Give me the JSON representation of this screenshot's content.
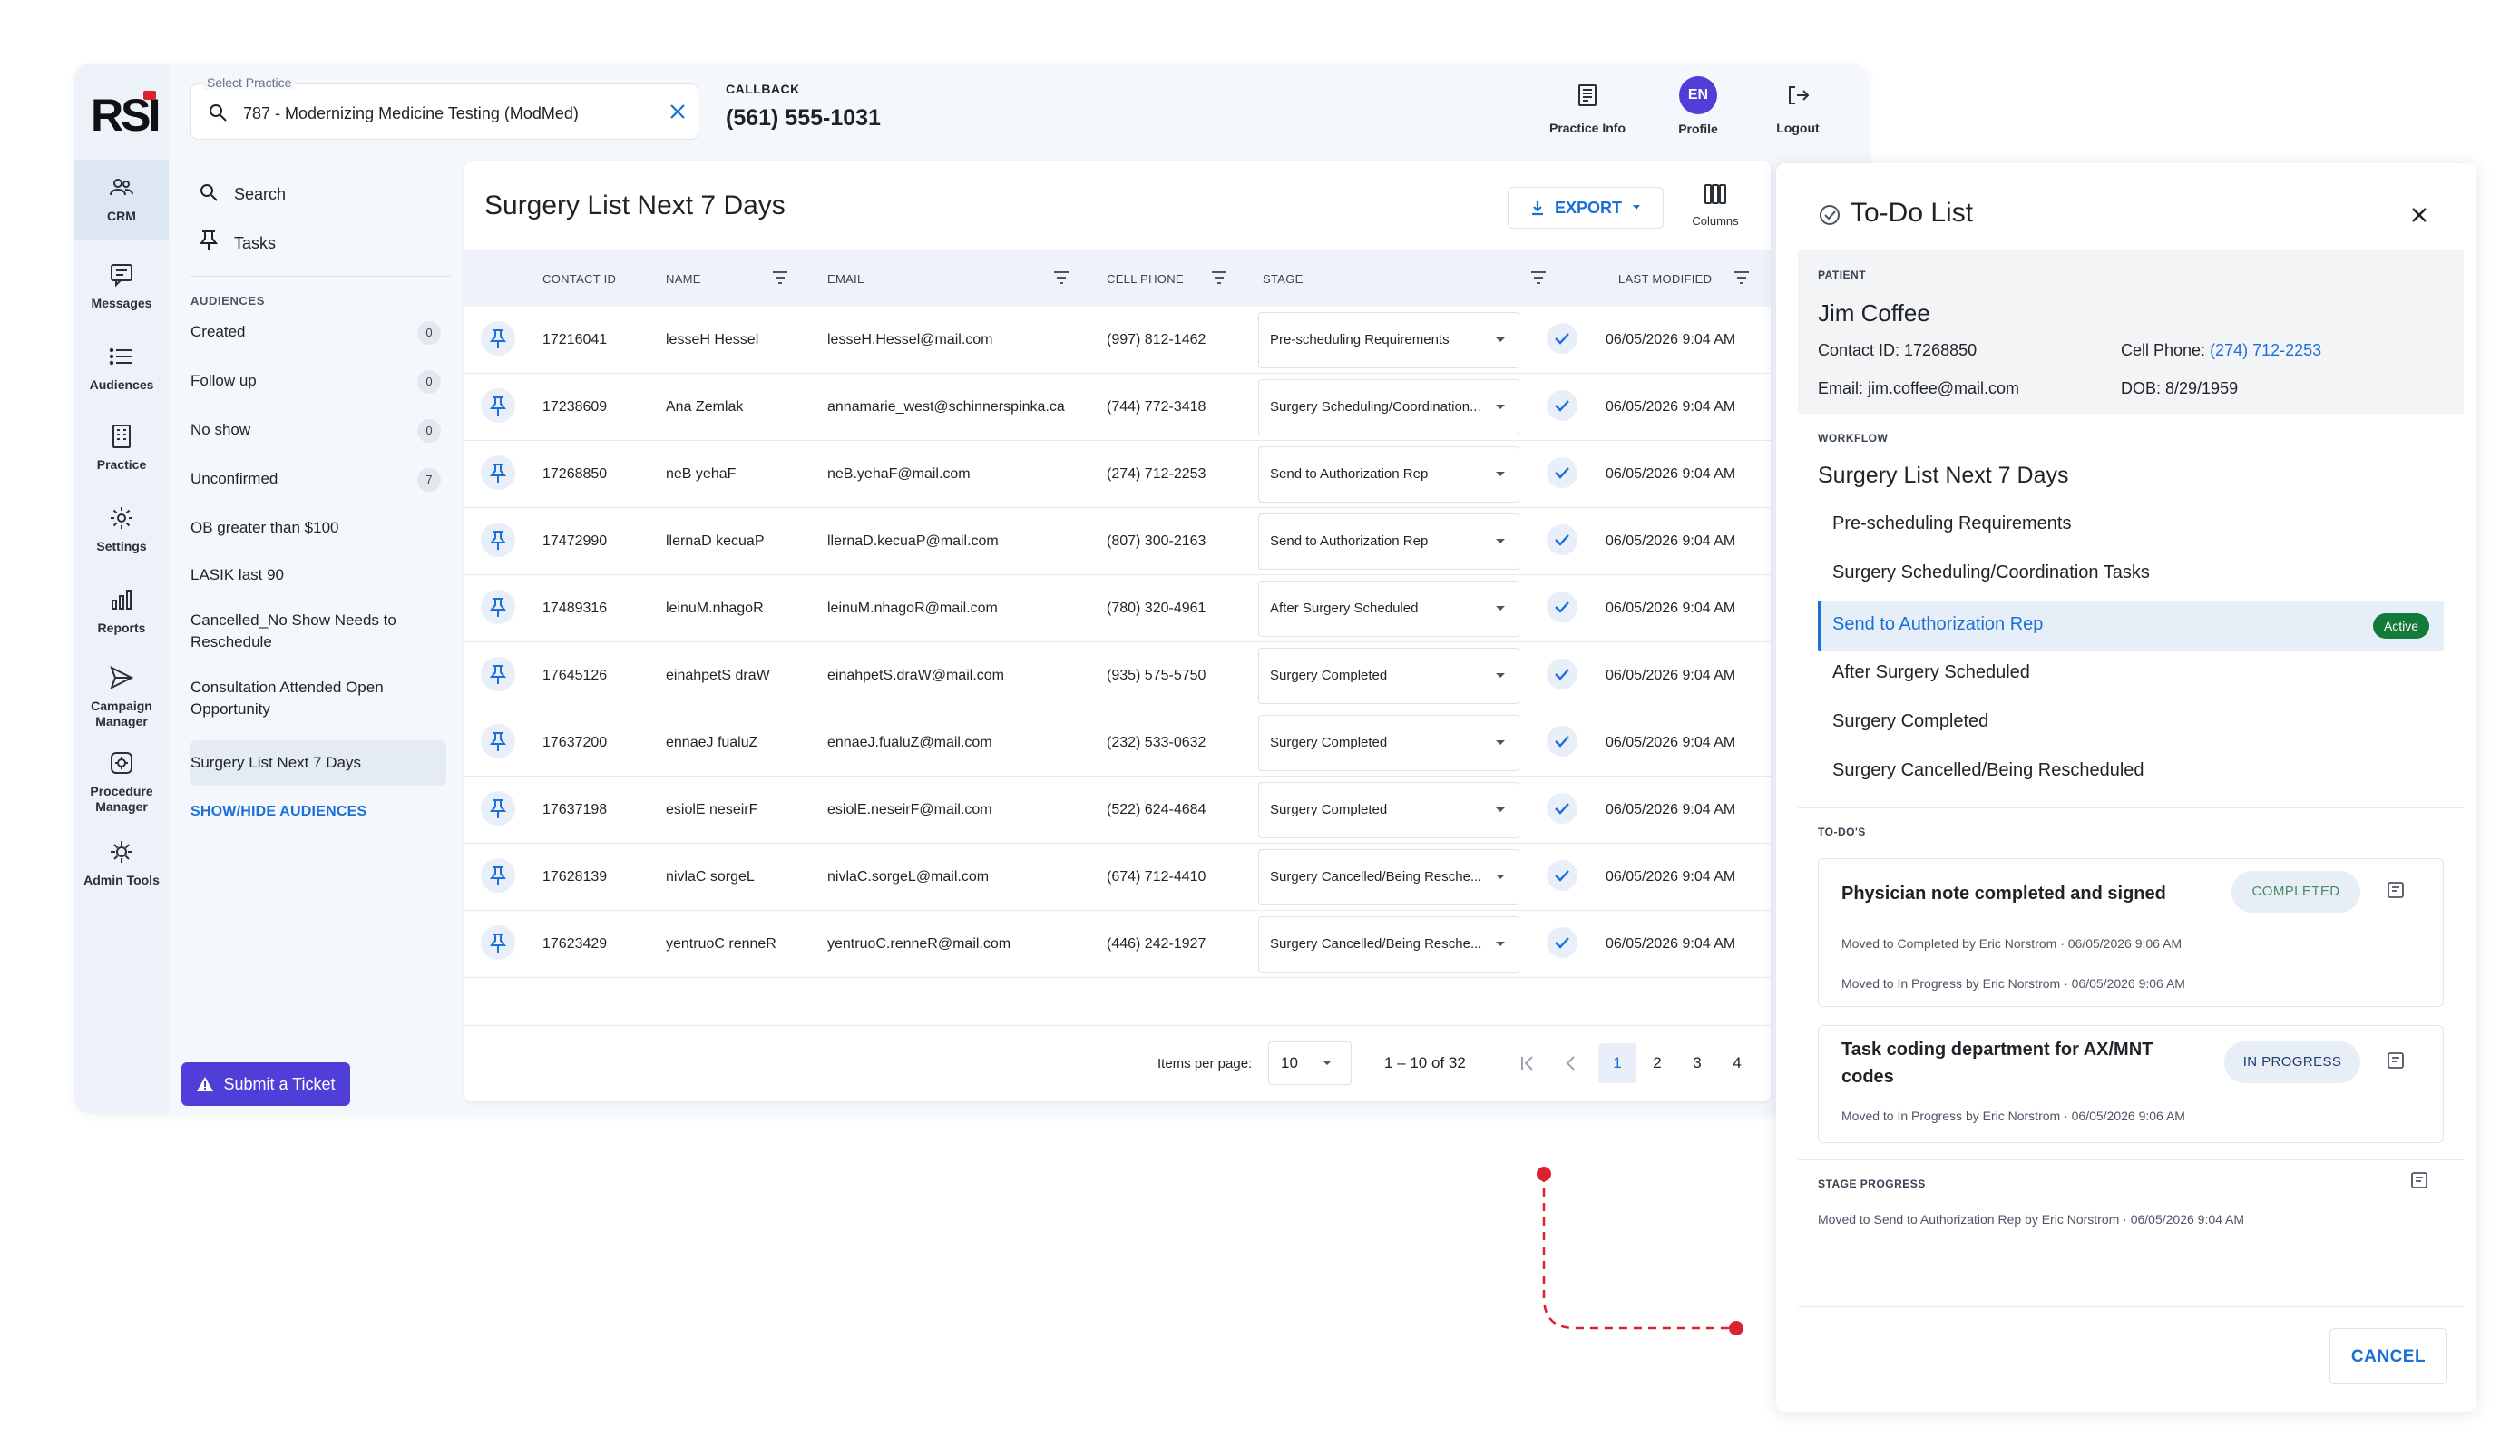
{
  "brand": {
    "logo_text": "RSI",
    "accent": "#1a6fd8",
    "brand_purple": "#4f3fd8",
    "logo_red": "#d9232e"
  },
  "rail": [
    {
      "label": "CRM",
      "icon": "users-icon"
    },
    {
      "label": "Messages",
      "icon": "message-icon"
    },
    {
      "label": "Audiences",
      "icon": "list-icon"
    },
    {
      "label": "Practice",
      "icon": "building-icon"
    },
    {
      "label": "Settings",
      "icon": "gear-icon"
    },
    {
      "label": "Reports",
      "icon": "bar-chart-icon"
    },
    {
      "label": "Campaign Manager",
      "icon": "send-icon"
    },
    {
      "label": "Procedure Manager",
      "icon": "procedure-icon"
    },
    {
      "label": "Admin Tools",
      "icon": "admin-gear-icon"
    }
  ],
  "topbar": {
    "select_label": "Select Practice",
    "select_value": "787 - Modernizing Medicine Testing (ModMed)",
    "callback_label": "CALLBACK",
    "callback_phone": "(561) 555-1031",
    "practice_info": "Practice Info",
    "profile_initials": "EN",
    "profile": "Profile",
    "logout": "Logout"
  },
  "sidebar": {
    "search": "Search",
    "tasks": "Tasks",
    "audiences_title": "AUDIENCES",
    "audiences": [
      {
        "label": "Created",
        "count": "0"
      },
      {
        "label": "Follow up",
        "count": "0"
      },
      {
        "label": "No show",
        "count": "0"
      },
      {
        "label": "Unconfirmed",
        "count": "7"
      },
      {
        "label": "OB greater than $100",
        "count": ""
      },
      {
        "label": "LASIK last 90",
        "count": ""
      },
      {
        "label": "Cancelled_No Show Needs to Reschedule",
        "count": ""
      },
      {
        "label": "Consultation Attended Open Opportunity",
        "count": ""
      },
      {
        "label": "Surgery List Next 7 Days",
        "count": ""
      }
    ],
    "show_hide": "SHOW/HIDE AUDIENCES",
    "submit_ticket": "Submit a Ticket"
  },
  "main": {
    "title": "Surgery List Next 7 Days",
    "export": "EXPORT",
    "columns": "Columns",
    "headers": [
      "CONTACT ID",
      "NAME",
      "EMAIL",
      "CELL PHONE",
      "STAGE",
      "LAST MODIFIED"
    ],
    "rows": [
      {
        "id": "17216041",
        "name": "lesseH Hessel",
        "email": "lesseH.Hessel@mail.com",
        "phone": "(997) 812-1462",
        "stage": "Pre-scheduling Requirements",
        "modified": "06/05/2026 9:04 AM"
      },
      {
        "id": "17238609",
        "name": "Ana Zemlak",
        "email": "annamarie_west@schinnerspinka.ca",
        "phone": "(744) 772-3418",
        "stage": "Surgery Scheduling/Coordination...",
        "modified": "06/05/2026 9:04 AM"
      },
      {
        "id": "17268850",
        "name": "neB yehaF",
        "email": "neB.yehaF@mail.com",
        "phone": "(274) 712-2253",
        "stage": "Send to Authorization Rep",
        "modified": "06/05/2026 9:04 AM"
      },
      {
        "id": "17472990",
        "name": "llernaD kecuaP",
        "email": "llernaD.kecuaP@mail.com",
        "phone": "(807) 300-2163",
        "stage": "Send to Authorization Rep",
        "modified": "06/05/2026 9:04 AM"
      },
      {
        "id": "17489316",
        "name": "leinuM.nhagoR",
        "email": "leinuM.nhagoR@mail.com",
        "phone": "(780) 320-4961",
        "stage": "After Surgery Scheduled",
        "modified": "06/05/2026 9:04 AM"
      },
      {
        "id": "17645126",
        "name": "einahpetS draW",
        "email": "einahpetS.draW@mail.com",
        "phone": "(935) 575-5750",
        "stage": "Surgery Completed",
        "modified": "06/05/2026 9:04 AM"
      },
      {
        "id": "17637200",
        "name": "ennaeJ fualuZ",
        "email": "ennaeJ.fualuZ@mail.com",
        "phone": "(232) 533-0632",
        "stage": "Surgery Completed",
        "modified": "06/05/2026 9:04 AM"
      },
      {
        "id": "17637198",
        "name": "esiolE neseirF",
        "email": "esiolE.neseirF@mail.com",
        "phone": "(522) 624-4684",
        "stage": "Surgery Completed",
        "modified": "06/05/2026 9:04 AM"
      },
      {
        "id": "17628139",
        "name": "nivlaC sorgeL",
        "email": "nivlaC.sorgeL@mail.com",
        "phone": "(674) 712-4410",
        "stage": "Surgery Cancelled/Being Resche...",
        "modified": "06/05/2026 9:04 AM"
      },
      {
        "id": "17623429",
        "name": "yentruoC renneR",
        "email": "yentruoC.renneR@mail.com",
        "phone": "(446) 242-1927",
        "stage": "Surgery Cancelled/Being Resche...",
        "modified": "06/05/2026 9:04 AM"
      }
    ],
    "pager": {
      "per_page_label": "Items per page:",
      "per_page": "10",
      "range": "1 – 10 of 32",
      "pages": [
        "1",
        "2",
        "3",
        "4"
      ],
      "current": "1"
    }
  },
  "todo": {
    "title": "To-Do List",
    "patient_label": "PATIENT",
    "patient_name": "Jim Coffee",
    "contact_id": "Contact ID: 17268850",
    "cell_label": "Cell Phone: ",
    "cell_phone": "(274) 712-2253",
    "email": "Email: jim.coffee@mail.com",
    "dob": "DOB: 8/29/1959",
    "workflow_label": "WORKFLOW",
    "workflow_name": "Surgery List Next 7 Days",
    "workflow_steps": [
      "Pre-scheduling Requirements",
      "Surgery Scheduling/Coordination Tasks",
      "Send to Authorization Rep",
      "After Surgery Scheduled",
      "Surgery Completed",
      "Surgery Cancelled/Being Rescheduled"
    ],
    "active_badge": "Active",
    "todos_label": "TO-DO'S",
    "todos": [
      {
        "title": "Physician note completed and signed",
        "status": "COMPLETED",
        "log": [
          "Moved to Completed by Eric Norstrom · 06/05/2026 9:06 AM",
          "Moved to In Progress by Eric Norstrom · 06/05/2026 9:06 AM"
        ]
      },
      {
        "title_line1": "Task coding department for AX/MNT",
        "title_line2": "codes",
        "status": "IN PROGRESS",
        "log": [
          "Moved to In Progress by Eric Norstrom · 06/05/2026 9:06 AM"
        ]
      }
    ],
    "stage_progress_label": "STAGE PROGRESS",
    "stage_progress_log": "Moved to Send to Authorization Rep by Eric Norstrom · 06/05/2026 9:04 AM",
    "cancel": "CANCEL"
  }
}
